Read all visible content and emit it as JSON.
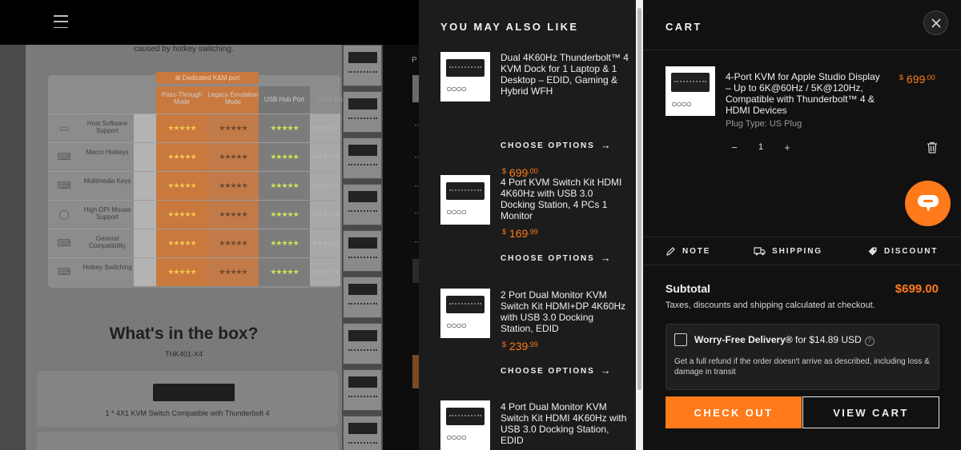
{
  "background": {
    "caption": "caused by hotkey switching.",
    "comparison": {
      "km_header": "⊞ Dedicated K&M port",
      "columns": [
        "Pass-Through Mode",
        "Legacy Emulation Mode",
        "USB Hub Port",
        "Other Brands"
      ],
      "rows": [
        {
          "label": "Host Software Support",
          "icon": "monitor-icon"
        },
        {
          "label": "Macro Hotkeys",
          "icon": "keyboard-icon"
        },
        {
          "label": "Multimedia Keys",
          "icon": "keyboard-icon"
        },
        {
          "label": "High-DPI Mouse Support",
          "icon": "mouse-icon"
        },
        {
          "label": "General Compatibility",
          "icon": "keyboard-icon"
        },
        {
          "label": "Hotkey Switching",
          "icon": "keyboard-icon"
        }
      ]
    },
    "box_title": "What's in the box?",
    "box_model": "THK401-X4",
    "box_item": "1 * 4X1 KVM Switch Compatible with Thunderbolt 4",
    "side_label": "P"
  },
  "recommendations": {
    "title": "YOU MAY ALSO LIKE",
    "choose_label": "CHOOSE OPTIONS",
    "arrow": "→",
    "items": [
      {
        "name": "Dual 4K60Hz Thunderbolt™ 4 KVM Dock for 1 Laptop & 1 Desktop – EDID, Gaming & Hybrid WFH",
        "currency": "$",
        "price_main": "699",
        "price_cents": ".00"
      },
      {
        "name": "4 Port KVM Switch Kit HDMI 4K60Hz with USB 3.0 Docking Station, 4 PCs 1 Monitor",
        "currency": "$",
        "price_main": "169",
        "price_cents": ".99"
      },
      {
        "name": "2 Port Dual Monitor KVM Switch Kit HDMI+DP 4K60Hz with USB 3.0 Docking Station, EDID",
        "currency": "$",
        "price_main": "239",
        "price_cents": ".99"
      },
      {
        "name": "4 Port Dual Monitor KVM Switch Kit HDMI 4K60Hz with USB 3.0 Docking Station, EDID",
        "currency": "",
        "price_main": "",
        "price_cents": ""
      }
    ]
  },
  "cart": {
    "title": "CART",
    "item": {
      "name": "4-Port KVM for Apple Studio Display – Up to 6K@60Hz / 5K@120Hz, Compatible with Thunderbolt™ 4 & HDMI Devices",
      "variant": "Plug Type: US Plug",
      "currency": "$",
      "price_main": "699",
      "price_cents": ".00",
      "quantity": "1",
      "minus": "−",
      "plus": "+"
    },
    "tabs": {
      "note": "NOTE",
      "shipping": "SHIPPING",
      "discount": "DISCOUNT"
    },
    "subtotal_label": "Subtotal",
    "subtotal_value": "$699.00",
    "tax_note": "Taxes, discounts and shipping calculated at checkout.",
    "worry_free": {
      "title": "Worry-Free Delivery®",
      "price_text": " for $14.89 USD",
      "info": "?",
      "description": "Get a full refund if the order doesn't arrive as described, including loss & damage in transit"
    },
    "checkout_label": "CHECK OUT",
    "view_cart_label": "VIEW CART"
  },
  "colors": {
    "accent": "#ff7a1a",
    "panel": "#1c1c1c",
    "cart_bg": "#111111",
    "km_column": "#c9783e"
  }
}
